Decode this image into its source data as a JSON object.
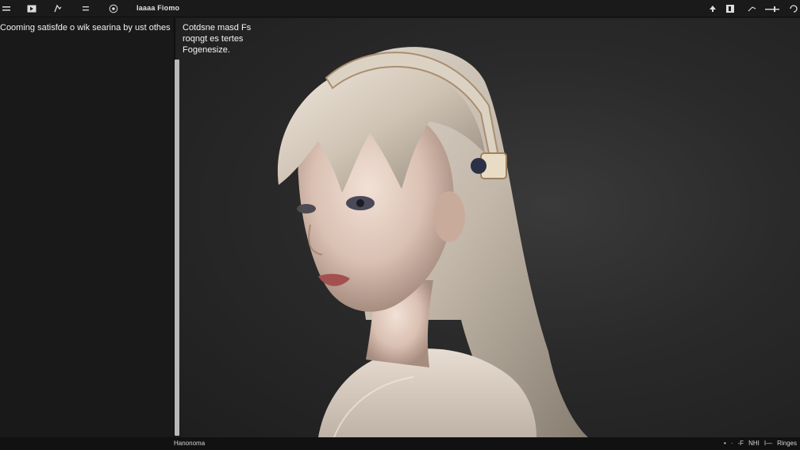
{
  "app": {
    "title": "Iaaaa Fiomo"
  },
  "toolbar_left": {
    "icons": [
      "menu-icon",
      "play-icon",
      "pen-icon",
      "list-icon",
      "settings-icon"
    ]
  },
  "toolbar_right": {
    "icons": [
      "arrow-up-icon",
      "panel-icon",
      "arrow-right-icon",
      "slider-icon",
      "refresh-icon"
    ]
  },
  "sidebar": {
    "text": "Cooming satisfde o wik searina by ust othes"
  },
  "canvas": {
    "caption": "Cotdsne masd Fs roqngt es tertes Fogenesize."
  },
  "status": {
    "left": "Hanonoma",
    "right_items": [
      "•",
      "·",
      "-F",
      "NHI",
      "I—",
      "Ringes"
    ]
  }
}
